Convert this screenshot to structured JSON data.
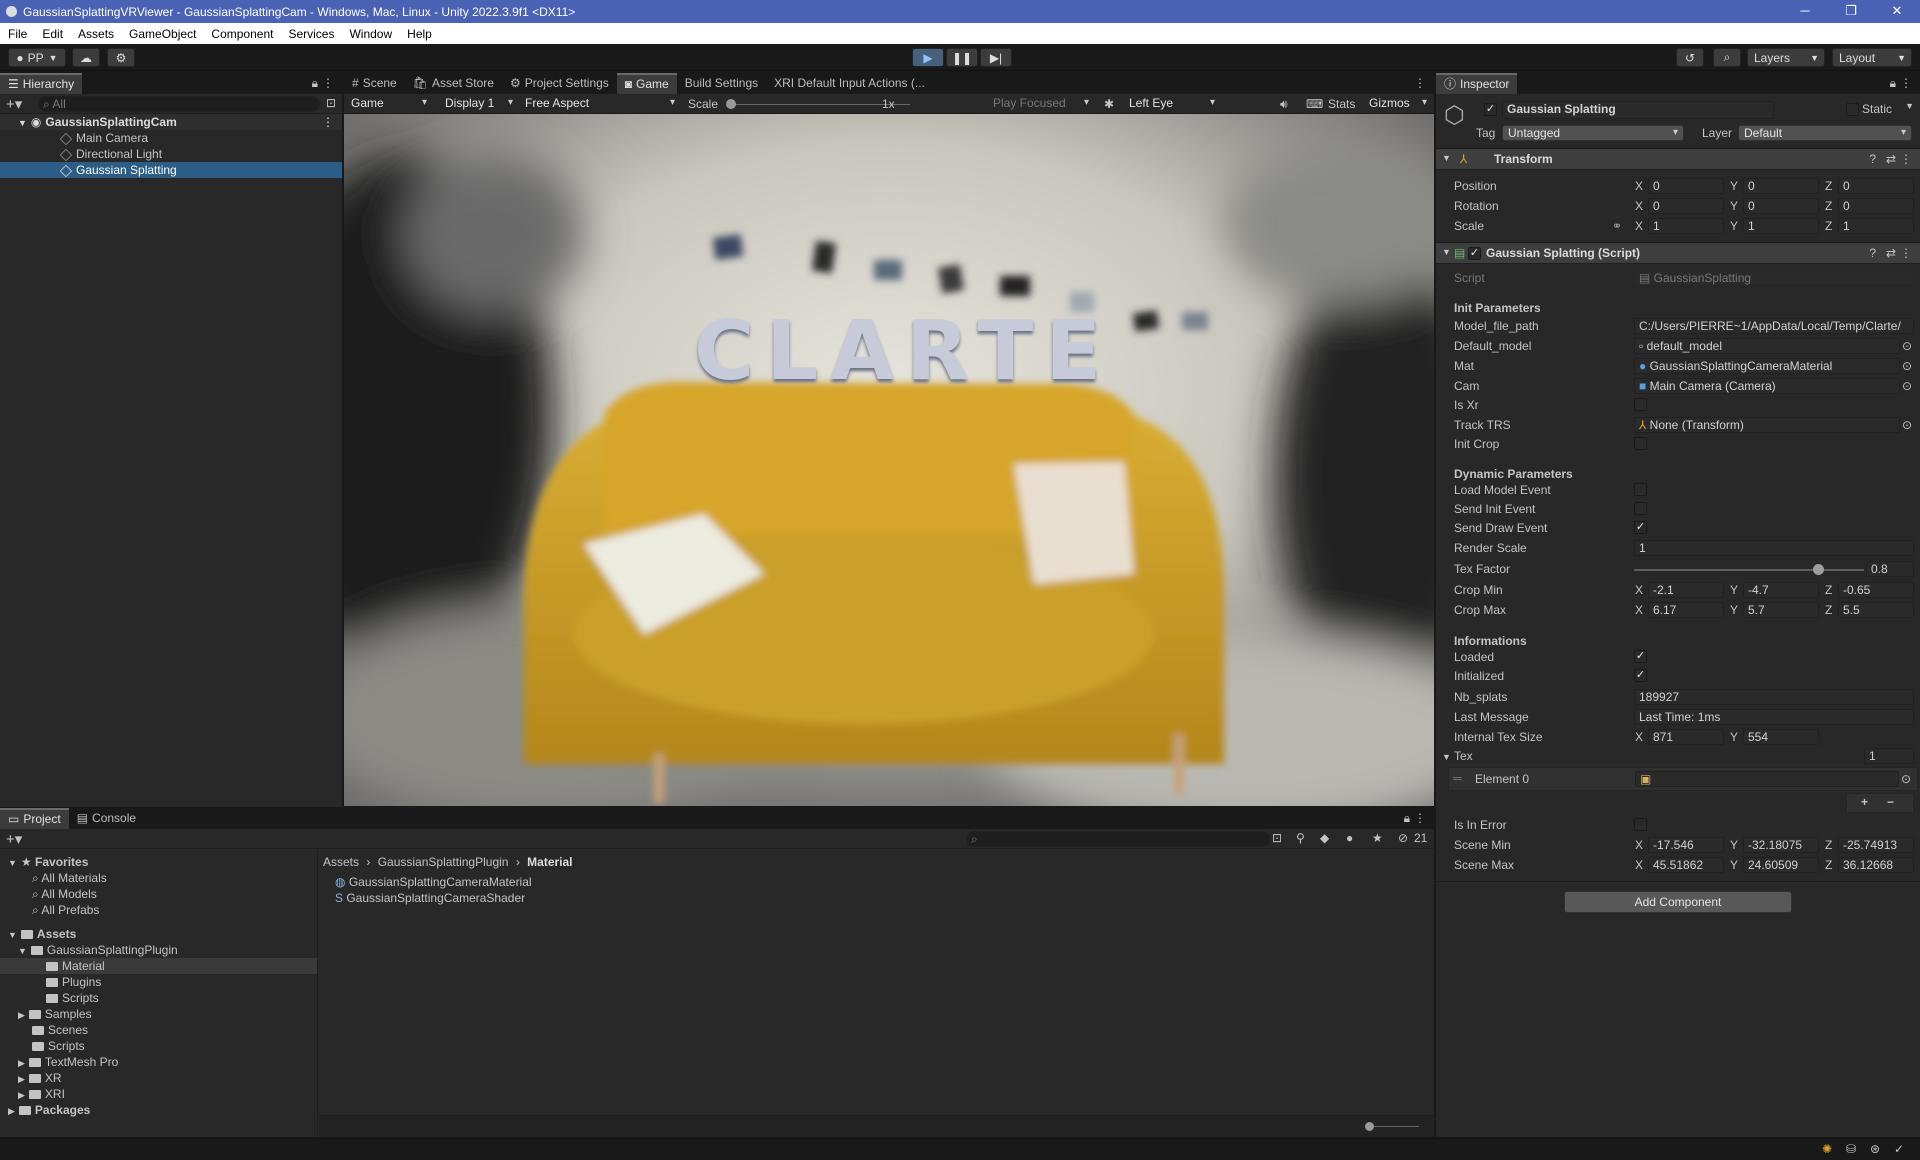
{
  "window": {
    "title": "GaussianSplattingVRViewer - GaussianSplattingCam - Windows, Mac, Linux - Unity 2022.3.9f1 <DX11>",
    "minimize": "─",
    "maximize": "❐",
    "close": "✕"
  },
  "menu": [
    "File",
    "Edit",
    "Assets",
    "GameObject",
    "Component",
    "Services",
    "Window",
    "Help"
  ],
  "toolbar": {
    "account": "PP",
    "layers": "Layers",
    "layout": "Layout"
  },
  "hierarchy": {
    "tab": "Hierarchy",
    "search_placeholder": "All",
    "scene": "GaussianSplattingCam",
    "items": [
      "Main Camera",
      "Directional Light",
      "Gaussian Splatting"
    ]
  },
  "center_tabs": [
    "Scene",
    "Asset Store",
    "Project Settings",
    "Game",
    "Build Settings",
    "XRI Default Input Actions (..."
  ],
  "game_toolbar": {
    "mode": "Game",
    "display": "Display 1",
    "aspect": "Free Aspect",
    "scale_label": "Scale",
    "scale_value": "1x",
    "play_focused": "Play Focused",
    "eye": "Left Eye",
    "stats": "Stats",
    "gizmos": "Gizmos"
  },
  "game_view": {
    "sign_text": "CLARTE"
  },
  "inspector": {
    "tab": "Inspector",
    "object_name": "Gaussian Splatting",
    "static_label": "Static",
    "tag_label": "Tag",
    "tag_value": "Untagged",
    "layer_label": "Layer",
    "layer_value": "Default",
    "transform": {
      "title": "Transform",
      "position": {
        "label": "Position",
        "x": "0",
        "y": "0",
        "z": "0"
      },
      "rotation": {
        "label": "Rotation",
        "x": "0",
        "y": "0",
        "z": "0"
      },
      "scale": {
        "label": "Scale",
        "x": "1",
        "y": "1",
        "z": "1"
      }
    },
    "script": {
      "title": "Gaussian Splatting (Script)",
      "script_label": "Script",
      "script_value": "GaussianSplatting",
      "init_header": "Init Parameters",
      "model_file_path_label": "Model_file_path",
      "model_file_path": "C:/Users/PIERRE~1/AppData/Local/Temp/Clarte/",
      "default_model_label": "Default_model",
      "default_model": "default_model",
      "mat_label": "Mat",
      "mat": "GaussianSplattingCameraMaterial",
      "cam_label": "Cam",
      "cam": "Main Camera (Camera)",
      "is_xr_label": "Is Xr",
      "track_trs_label": "Track TRS",
      "track_trs": "None (Transform)",
      "init_crop_label": "Init Crop",
      "dynamic_header": "Dynamic Parameters",
      "load_model_event_label": "Load Model Event",
      "send_init_event_label": "Send Init Event",
      "send_draw_event_label": "Send Draw Event",
      "render_scale_label": "Render Scale",
      "render_scale": "1",
      "tex_factor_label": "Tex Factor",
      "tex_factor": "0.8",
      "tex_factor_fraction": 0.8,
      "crop_min": {
        "label": "Crop Min",
        "x": "-2.1",
        "y": "-4.7",
        "z": "-0.65"
      },
      "crop_max": {
        "label": "Crop Max",
        "x": "6.17",
        "y": "5.7",
        "z": "5.5"
      },
      "info_header": "Informations",
      "loaded_label": "Loaded",
      "initialized_label": "Initialized",
      "nb_splats_label": "Nb_splats",
      "nb_splats": "189927",
      "last_message_label": "Last Message",
      "last_message": "Last Time: 1ms",
      "internal_tex_size": {
        "label": "Internal Tex Size",
        "x": "871",
        "y": "554"
      },
      "tex_label": "Tex",
      "tex_count": "1",
      "element0_label": "Element 0",
      "add": "+",
      "remove": "−",
      "is_in_error_label": "Is In Error",
      "scene_min": {
        "label": "Scene Min",
        "x": "-17.546",
        "y": "-32.18075",
        "z": "-25.74913"
      },
      "scene_max": {
        "label": "Scene Max",
        "x": "45.51862",
        "y": "24.60509",
        "z": "36.12668"
      }
    },
    "add_component": "Add Component",
    "axis": {
      "x": "X",
      "y": "Y",
      "z": "Z"
    }
  },
  "project": {
    "tabs": [
      "Project",
      "Console"
    ],
    "favorites_header": "Favorites",
    "favorites": [
      "All Materials",
      "All Models",
      "All Prefabs"
    ],
    "assets_header": "Assets",
    "plugin_folder": "GaussianSplattingPlugin",
    "plugin_children": [
      "Material",
      "Plugins",
      "Scripts"
    ],
    "asset_folders": [
      "Samples",
      "Scenes",
      "Scripts",
      "TextMesh Pro",
      "XR",
      "XRI"
    ],
    "packages_header": "Packages",
    "breadcrumb": [
      "Assets",
      "GaussianSplattingPlugin",
      "Material"
    ],
    "files": [
      "GaussianSplattingCameraMaterial",
      "GaussianSplattingCameraShader"
    ],
    "hidden_count": "21"
  }
}
